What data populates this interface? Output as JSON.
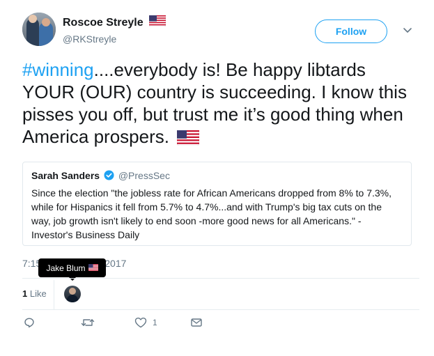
{
  "author": {
    "display_name": "Roscoe Streyle",
    "handle": "@RKStreyle",
    "avatar_icon": "profile-photo",
    "flag_icon": "us-flag-icon"
  },
  "follow_button": {
    "label": "Follow"
  },
  "tweet": {
    "hashtag": "#winning",
    "text": "....everybody is!  Be happy libtards YOUR (OUR) country is succeeding.  I know this pisses you off, but trust me it’s good thing when America prospers."
  },
  "quoted_tweet": {
    "name": "Sarah Sanders",
    "handle": "@PressSec",
    "text": "Since the election \"the jobless rate for African Americans dropped from 8% to 7.3%, while for Hispanics it fell from 5.7% to 4.7%...and with Trump's big tax cuts on the way, job growth isn't likely to end soon -more good news for all Americans.\" - Investor's Business Daily"
  },
  "timestamp": {
    "start": "7:15",
    "end": "2017"
  },
  "tooltip": {
    "name": "Jake Blum"
  },
  "likes": {
    "count": "1",
    "label": "Like"
  },
  "actions": {
    "reply_icon": "reply-icon",
    "retweet_icon": "retweet-icon",
    "like_icon": "heart-icon",
    "like_count": "1",
    "dm_icon": "envelope-icon"
  },
  "colors": {
    "accent": "#1da1f2",
    "text": "#14171a",
    "secondary": "#657786",
    "border": "#e1e8ed"
  }
}
